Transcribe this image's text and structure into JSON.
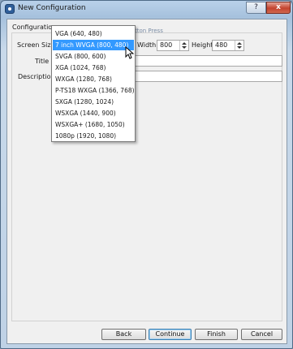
{
  "window": {
    "title": "New Configuration",
    "help_glyph": "?",
    "close_glyph": "x",
    "ghost_text": "Ac Button Press"
  },
  "form": {
    "group_label": "Configuration",
    "screen_size_label": "Screen Size",
    "width_label": "Width",
    "width_value": "800",
    "height_label": "Height",
    "height_value": "480",
    "title_label": "Title",
    "title_value": "",
    "description_label": "Description",
    "description_value": ""
  },
  "screen_size_options": [
    "VGA (640, 480)",
    "7 inch WVGA (800, 480)",
    "SVGA (800, 600)",
    "XGA (1024, 768)",
    "WXGA (1280, 768)",
    "P-TS18 WXGA (1366, 768)",
    "SXGA (1280, 1024)",
    "WSXGA (1440, 900)",
    "WSXGA+ (1680, 1050)",
    "1080p (1920, 1080)"
  ],
  "selected_option": "7 inch WVGA (800, 480)",
  "buttons": {
    "back": "Back",
    "continue": "Continue",
    "finish": "Finish",
    "cancel": "Cancel"
  }
}
